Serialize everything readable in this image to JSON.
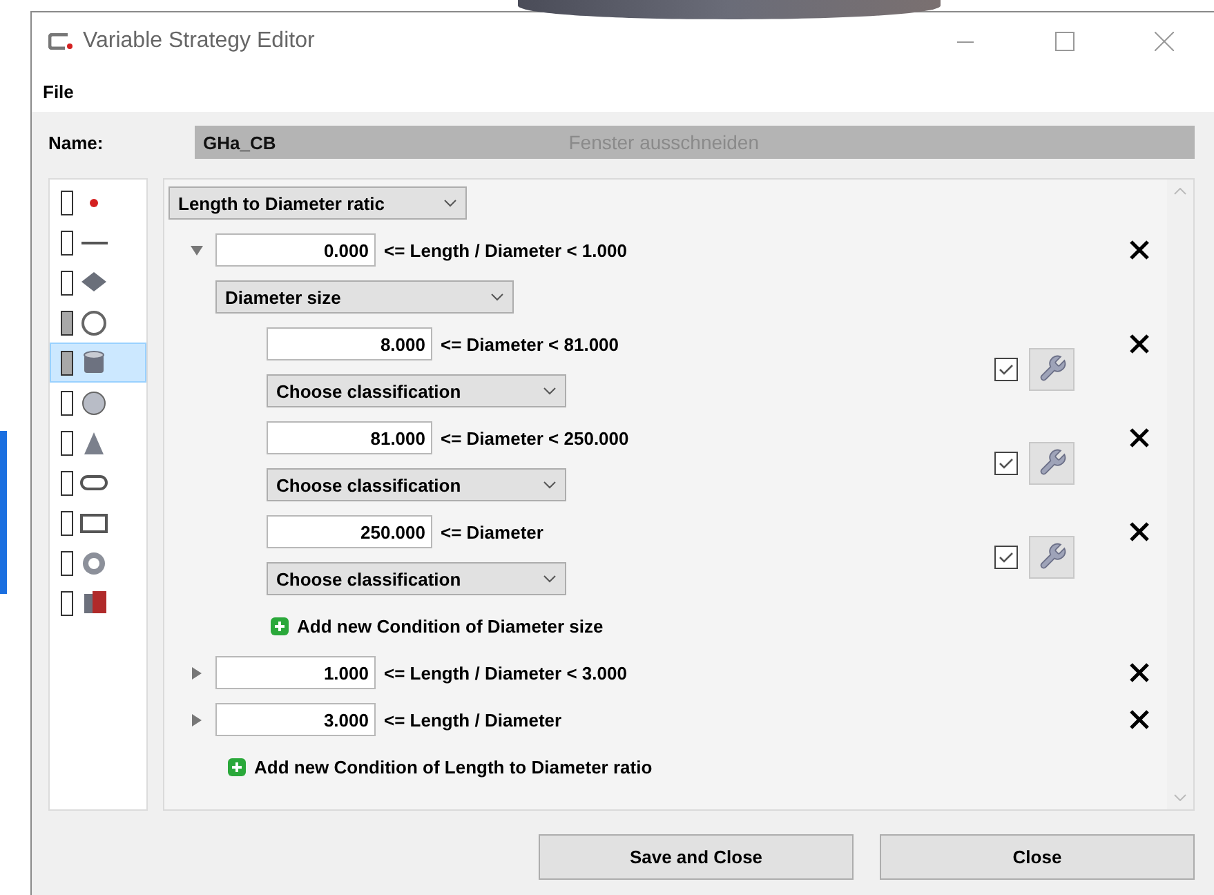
{
  "window": {
    "title": "Variable Strategy Editor"
  },
  "menu": [
    "File"
  ],
  "name": {
    "label": "Name:",
    "value": "GHa_CB",
    "overlay_hint": "Fenster ausschneiden"
  },
  "shapes": [
    {
      "kind": "point",
      "marked": false,
      "selected": false
    },
    {
      "kind": "line",
      "marked": false,
      "selected": false
    },
    {
      "kind": "plane",
      "marked": false,
      "selected": false
    },
    {
      "kind": "circle",
      "marked": true,
      "selected": false
    },
    {
      "kind": "cylinder",
      "marked": true,
      "selected": true
    },
    {
      "kind": "sphere",
      "marked": false,
      "selected": false
    },
    {
      "kind": "cone",
      "marked": false,
      "selected": false
    },
    {
      "kind": "slot",
      "marked": false,
      "selected": false
    },
    {
      "kind": "rectangle",
      "marked": false,
      "selected": false
    },
    {
      "kind": "torus",
      "marked": false,
      "selected": false
    },
    {
      "kind": "solid",
      "marked": false,
      "selected": false
    }
  ],
  "strategy": {
    "criterion": "Length to Diameter ratic",
    "conditions": [
      {
        "expanded": true,
        "value": "0.000",
        "relation": "<= Length / Diameter < 1.000",
        "sub": {
          "criterion": "Diameter size",
          "conditions": [
            {
              "value": "8.000",
              "relation": "<= Diameter < 81.000",
              "classification": "Choose classification",
              "checked": true
            },
            {
              "value": "81.000",
              "relation": "<= Diameter < 250.000",
              "classification": "Choose classification",
              "checked": true
            },
            {
              "value": "250.000",
              "relation": "<= Diameter",
              "classification": "Choose classification",
              "checked": true
            }
          ],
          "add_label": "Add new Condition of Diameter size"
        }
      },
      {
        "expanded": false,
        "value": "1.000",
        "relation": "<= Length / Diameter < 3.000"
      },
      {
        "expanded": false,
        "value": "3.000",
        "relation": "<= Length / Diameter"
      }
    ],
    "add_label": "Add new Condition of Length to Diameter ratio"
  },
  "buttons": [
    "Save and Close",
    "Close"
  ]
}
